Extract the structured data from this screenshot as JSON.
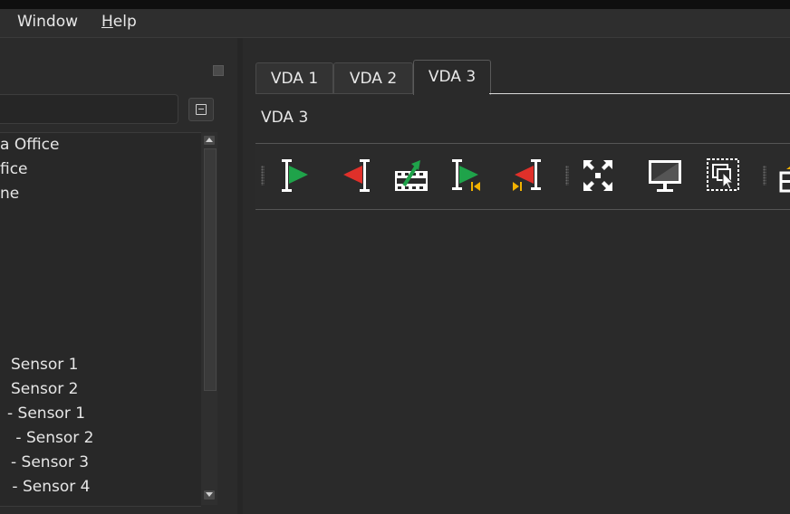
{
  "menu": {
    "window": "Window",
    "help_u": "H",
    "help_rest": "elp"
  },
  "tree": {
    "items": [
      "a Office",
      "fice",
      "ne",
      "Sensor 1",
      "Sensor 2",
      "- Sensor 1",
      " - Sensor 2",
      "- Sensor 3",
      " - Sensor 4"
    ]
  },
  "tabs": [
    "VDA 1",
    "VDA 2",
    "VDA 3"
  ],
  "active_tab": "VDA 3",
  "content": {
    "title": "VDA 3"
  },
  "colors": {
    "accent_green": "#1fa34a",
    "accent_red": "#e0302a",
    "accent_yellow": "#f2b200"
  },
  "toolbar_icons": [
    "set-start-marker-icon",
    "set-end-marker-icon",
    "export-clip-icon",
    "go-to-start-marker-icon",
    "go-to-end-marker-icon",
    "fit-to-view-icon",
    "display-icon",
    "select-region-icon",
    "partial-icon"
  ]
}
